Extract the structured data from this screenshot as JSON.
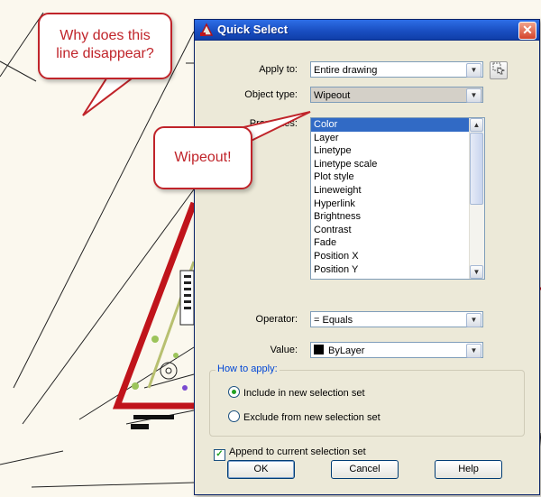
{
  "dialog": {
    "title": "Quick Select",
    "close_symbol": "✕",
    "apply_to": {
      "label": "Apply to:",
      "value": "Entire drawing"
    },
    "object_type": {
      "label": "Object type:",
      "value": "Wipeout"
    },
    "properties": {
      "label": "Properties:",
      "items": [
        "Color",
        "Layer",
        "Linetype",
        "Linetype scale",
        "Plot style",
        "Lineweight",
        "Hyperlink",
        "Brightness",
        "Contrast",
        "Fade",
        "Position X",
        "Position Y"
      ]
    },
    "operator": {
      "label": "Operator:",
      "value": "= Equals"
    },
    "value": {
      "label": "Value:",
      "value": "ByLayer"
    },
    "how_to_apply": {
      "title": "How to apply:",
      "include": "Include in new selection set",
      "exclude": "Exclude from new selection set"
    },
    "append_label": "Append to current selection set",
    "buttons": {
      "ok": "OK",
      "cancel": "Cancel",
      "help": "Help"
    }
  },
  "callouts": {
    "question": [
      "Why does this",
      "line disappear?"
    ],
    "answer": "Wipeout!"
  },
  "icons": {
    "app": "autocad-icon",
    "pick": "select-objects-icon"
  },
  "colors": {
    "callout_red": "#c0242a",
    "selection_blue": "#316ac5",
    "title_blue": "#1a4fc2"
  }
}
